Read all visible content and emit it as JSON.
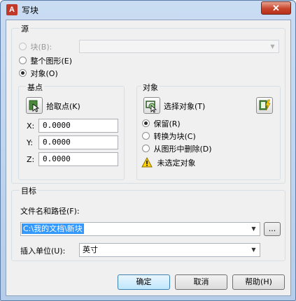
{
  "window": {
    "title": "写块",
    "close_glyph": "✕"
  },
  "source": {
    "label": "源",
    "options": [
      "块(B):",
      "整个图形(E)",
      "对象(O)"
    ],
    "selected": "对象(O)",
    "block_combo_value": ""
  },
  "base_point": {
    "label": "基点",
    "pick_label": "拾取点(K)",
    "fields": [
      {
        "axis": "X:",
        "value": "0.0000"
      },
      {
        "axis": "Y:",
        "value": "0.0000"
      },
      {
        "axis": "Z:",
        "value": "0.0000"
      }
    ]
  },
  "objects": {
    "label": "对象",
    "select_label": "选择对象(T)",
    "options": [
      "保留(R)",
      "转换为块(C)",
      "从图形中删除(D)"
    ],
    "selected": "保留(R)",
    "warning": "未选定对象"
  },
  "target": {
    "label": "目标",
    "path_label": "文件名和路径(F):",
    "path_value": "C:\\我的文档\\新块",
    "browse_label": "...",
    "units_label": "插入单位(U):",
    "units_value": "英寸"
  },
  "buttons": {
    "ok": "确定",
    "cancel": "取消",
    "help": "帮助(H)"
  },
  "icons": {
    "app": "autocad-a-icon",
    "pick": "pick-point-icon",
    "select": "select-objects-icon",
    "quick_select": "quick-select-icon",
    "warning": "warning-icon"
  },
  "colors": {
    "accent_selection": "#3399ff",
    "warning_yellow": "#ffd200"
  }
}
